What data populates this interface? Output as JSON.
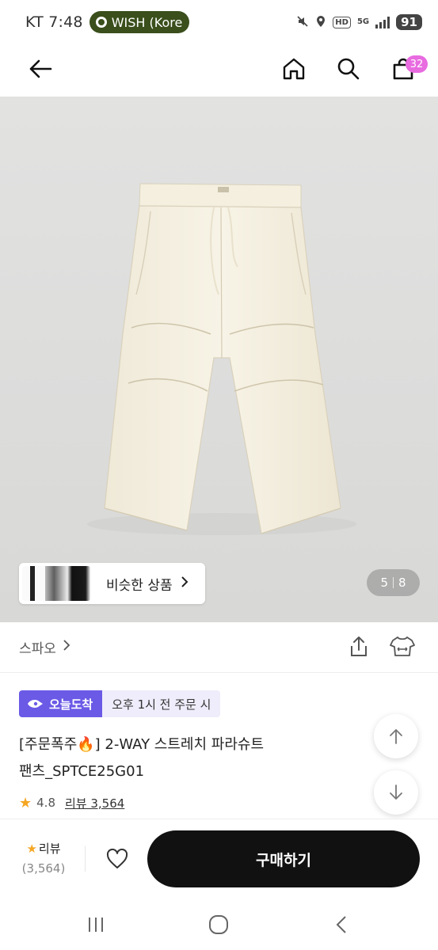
{
  "status_bar": {
    "carrier": "KT",
    "time": "7:48",
    "notification": "WISH (Kore",
    "hd": "HD",
    "network": "5G",
    "battery": "91"
  },
  "nav": {
    "cart_count": "32",
    "icons": [
      "back-arrow-icon",
      "home-icon",
      "search-icon",
      "shopping-bag-icon"
    ]
  },
  "gallery": {
    "similar_label": "비슷한 상품",
    "current": "5",
    "total": "8"
  },
  "brand": {
    "name": "스파오"
  },
  "delivery": {
    "badge": "오늘도착",
    "note": "오후 1시 전 주문 시",
    "accent": "#6b5ae6"
  },
  "product": {
    "title_line1": "[주문폭주🔥] 2-WAY 스트레치 파라슈트",
    "title_line2": "팬츠_SPTCE25G01",
    "rating": "4.8",
    "review_link": "리뷰 3,564"
  },
  "action_bar": {
    "review_label": "리뷰",
    "review_count": "(3,564)",
    "buy_label": "구매하기"
  },
  "colors": {
    "badge_pink": "#e86be0",
    "buy_button": "#111111",
    "star": "#f5a623"
  }
}
